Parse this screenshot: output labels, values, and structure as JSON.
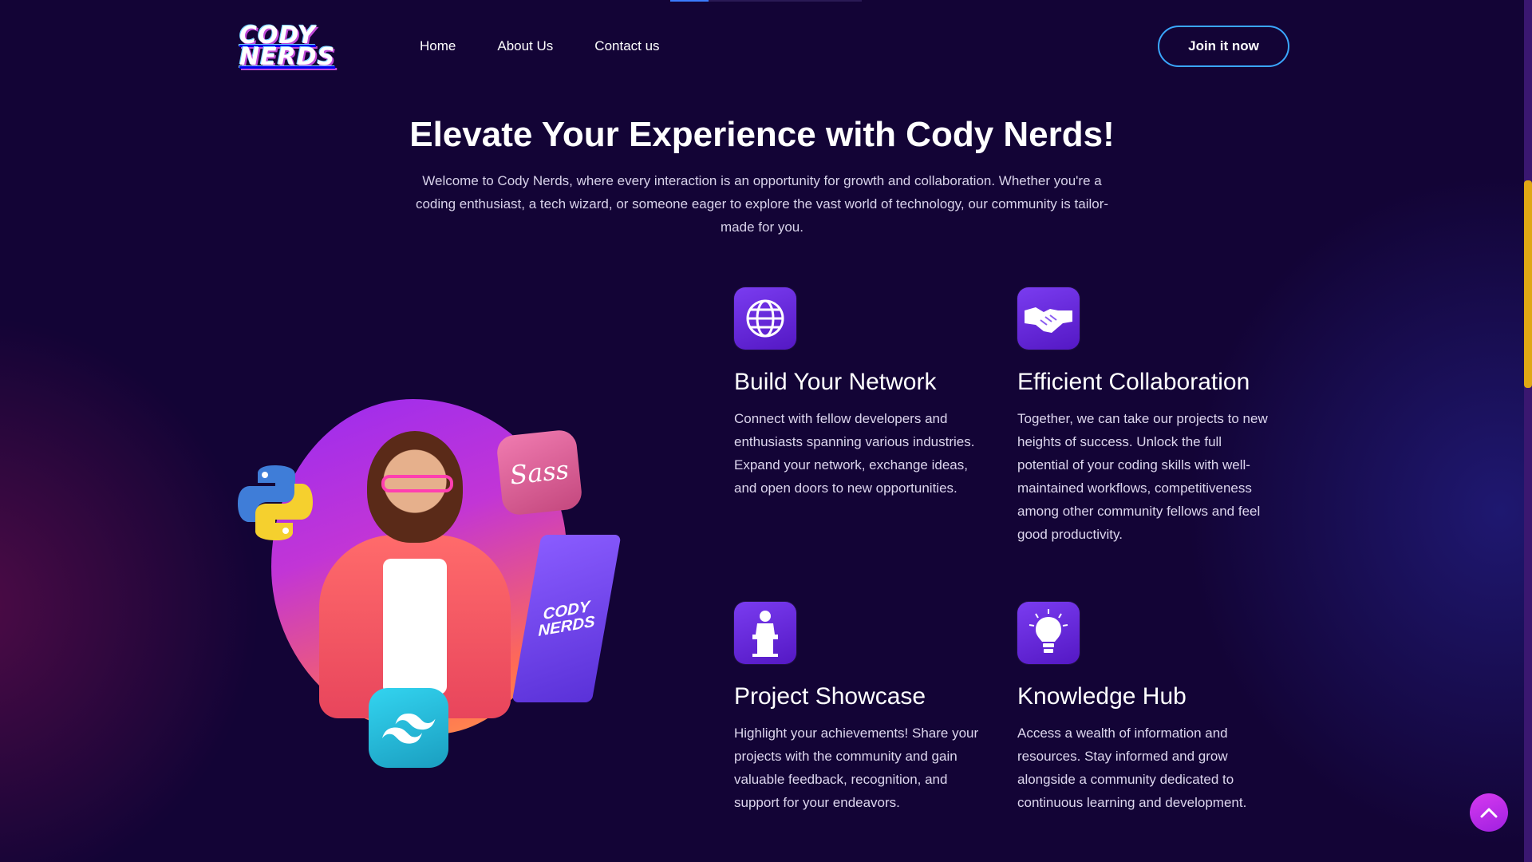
{
  "header": {
    "logo_line1": "CODY",
    "logo_line2": "NERDS",
    "nav": [
      {
        "label": "Home"
      },
      {
        "label": "About Us"
      },
      {
        "label": "Contact us"
      }
    ],
    "cta_label": "Join it now"
  },
  "hero": {
    "title": "Elevate Your Experience with Cody Nerds!",
    "description": "Welcome to Cody Nerds, where every interaction is an opportunity for growth and collaboration. Whether you're a coding enthusiast, a tech wizard, or someone eager to explore the vast world of technology, our community is tailor-made for you."
  },
  "illustration": {
    "laptop_text_line1": "CODY",
    "laptop_text_line2": "NERDS",
    "sass_label": "Sass"
  },
  "features": [
    {
      "icon": "globe-icon",
      "title": "Build Your Network",
      "text": "Connect with fellow developers and enthusiasts spanning various industries. Expand your network, exchange ideas, and open doors to new opportunities."
    },
    {
      "icon": "handshake-icon",
      "title": "Efficient Collaboration",
      "text": "Together, we can take our projects to new heights of success. Unlock the full potential of your coding skills with well-maintained workflows, competitiveness among other community fellows and feel good productivity."
    },
    {
      "icon": "podium-icon",
      "title": "Project Showcase",
      "text": "Highlight your achievements! Share your projects with the community and gain valuable feedback, recognition, and support for your endeavors."
    },
    {
      "icon": "lightbulb-icon",
      "title": "Knowledge Hub",
      "text": "Access a wealth of information and resources. Stay informed and grow alongside a community dedicated to continuous learning and development."
    }
  ],
  "colors": {
    "background": "#130436",
    "accent_border": "#3aa7ff",
    "icon_bg": "#6a2ce0",
    "scroll_thumb": "#e0a814",
    "back_to_top": "#c22ee8"
  }
}
